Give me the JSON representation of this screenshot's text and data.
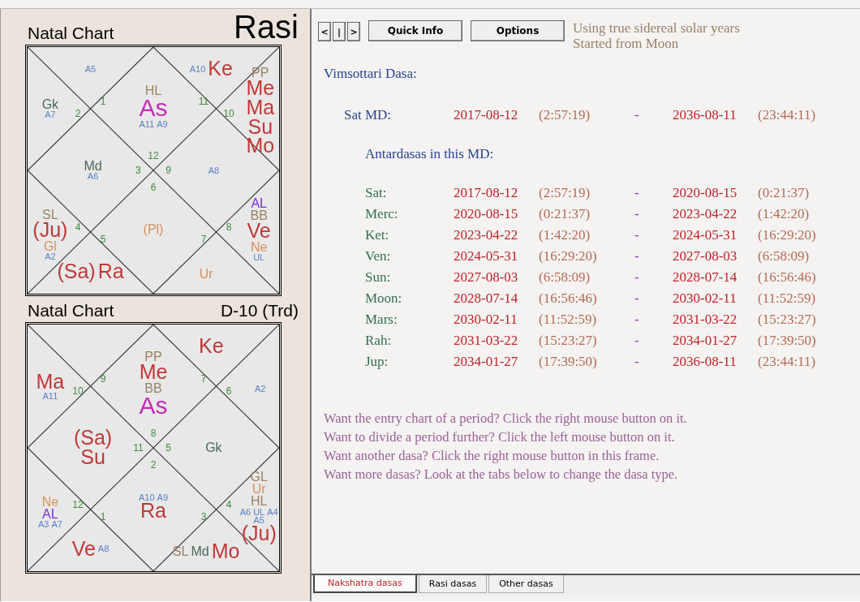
{
  "charts": [
    {
      "title": "Natal Chart",
      "name": "Rasi",
      "name_large": true,
      "houses": [
        {
          "kind": "top_left",
          "sign": "1",
          "labels": [
            {
              "text": "A5",
              "kind": "arudha"
            }
          ]
        },
        {
          "kind": "top_right",
          "sign": "11",
          "labels": [
            {
              "text": "A10",
              "kind": "arudha"
            },
            {
              "text": "Ke",
              "kind": "planet"
            }
          ]
        },
        {
          "kind": "left_top",
          "sign": "2",
          "labels": [
            {
              "text": "Gk",
              "kind": "upagraha"
            },
            {
              "text": "A7",
              "kind": "arudha"
            }
          ]
        },
        {
          "kind": "top_diamond",
          "sign": "12",
          "labels": [
            {
              "text": "HL",
              "kind": "special_lagna"
            },
            {
              "text": "As",
              "kind": "ascendant"
            },
            {
              "text": "A11",
              "kind": "arudha"
            },
            {
              "text": "A9",
              "kind": "arudha"
            }
          ]
        },
        {
          "kind": "right_top",
          "sign": "10",
          "labels": [
            {
              "text": "PP",
              "kind": "special_lagna"
            },
            {
              "text": "Me",
              "kind": "planet"
            },
            {
              "text": "Ma",
              "kind": "planet"
            },
            {
              "text": "Su",
              "kind": "planet"
            },
            {
              "text": "Mo",
              "kind": "planet"
            }
          ]
        },
        {
          "kind": "left_diamond",
          "sign": "3",
          "labels": [
            {
              "text": "Md",
              "kind": "upagraha"
            },
            {
              "text": "A6",
              "kind": "arudha"
            }
          ]
        },
        {
          "kind": "right_diamond",
          "sign": "9",
          "labels": [
            {
              "text": "A8",
              "kind": "arudha"
            }
          ]
        },
        {
          "kind": "left_bottom",
          "sign": "4",
          "labels": [
            {
              "text": "SL",
              "kind": "special_lagna"
            },
            {
              "text": "(Ju)",
              "kind": "planet"
            },
            {
              "text": "Gl",
              "kind": "outer"
            },
            {
              "text": "A2",
              "kind": "arudha"
            }
          ]
        },
        {
          "kind": "bottom_diamond",
          "sign": "6",
          "labels": [
            {
              "text": "(Pl)",
              "kind": "outer"
            }
          ]
        },
        {
          "kind": "right_bottom",
          "sign": "8",
          "labels": [
            {
              "text": "AL",
              "kind": "arudha_lagna"
            },
            {
              "text": "BB",
              "kind": "special_lagna"
            },
            {
              "text": "Ve",
              "kind": "planet"
            },
            {
              "text": "Ne",
              "kind": "outer"
            },
            {
              "text": "UL",
              "kind": "arudha"
            }
          ]
        },
        {
          "kind": "bottom_left",
          "sign": "5",
          "labels": [
            {
              "text": "(Sa)",
              "kind": "planet"
            },
            {
              "text": "Ra",
              "kind": "planet"
            }
          ]
        },
        {
          "kind": "bottom_right",
          "sign": "7",
          "labels": [
            {
              "text": "Ur",
              "kind": "outer"
            }
          ]
        }
      ]
    },
    {
      "title": "Natal Chart",
      "name": "D-10 (Trd)",
      "name_large": false,
      "houses": [
        {
          "kind": "top_left",
          "sign": "9"
        },
        {
          "kind": "top_right",
          "sign": "7",
          "labels": [
            {
              "text": "Ke",
              "kind": "planet"
            }
          ]
        },
        {
          "kind": "left_top",
          "sign": "10",
          "labels": [
            {
              "text": "Ma",
              "kind": "planet"
            },
            {
              "text": "A11",
              "kind": "arudha"
            }
          ]
        },
        {
          "kind": "top_diamond",
          "sign": "8",
          "labels": [
            {
              "text": "PP",
              "kind": "special_lagna"
            },
            {
              "text": "Me",
              "kind": "planet"
            },
            {
              "text": "BB",
              "kind": "special_lagna"
            },
            {
              "text": "As",
              "kind": "ascendant"
            }
          ]
        },
        {
          "kind": "right_top",
          "sign": "6",
          "labels": [
            {
              "text": "A2",
              "kind": "arudha"
            }
          ]
        },
        {
          "kind": "left_diamond",
          "sign": "11",
          "labels": [
            {
              "text": "(Sa)",
              "kind": "planet"
            },
            {
              "text": "Su",
              "kind": "planet"
            }
          ]
        },
        {
          "kind": "right_diamond",
          "sign": "5",
          "labels": [
            {
              "text": "Gk",
              "kind": "upagraha"
            }
          ]
        },
        {
          "kind": "left_bottom",
          "sign": "12",
          "labels": [
            {
              "text": "Ne",
              "kind": "outer"
            },
            {
              "text": "AL",
              "kind": "arudha_lagna"
            },
            {
              "text": "A3",
              "kind": "arudha"
            },
            {
              "text": "A7",
              "kind": "arudha"
            }
          ]
        },
        {
          "kind": "bottom_diamond",
          "sign": "2",
          "labels": [
            {
              "text": "A10",
              "kind": "arudha"
            },
            {
              "text": "A9",
              "kind": "arudha"
            },
            {
              "text": "Ra",
              "kind": "planet"
            }
          ]
        },
        {
          "kind": "right_bottom",
          "sign": "4",
          "labels": [
            {
              "text": "GL",
              "kind": "special_lagna"
            },
            {
              "text": "Ur",
              "kind": "outer"
            },
            {
              "text": "HL",
              "kind": "special_lagna"
            },
            {
              "text": "A6",
              "kind": "arudha"
            },
            {
              "text": "UL",
              "kind": "arudha"
            },
            {
              "text": "A4",
              "kind": "arudha"
            },
            {
              "text": "A5",
              "kind": "arudha"
            },
            {
              "text": "(Ju)",
              "kind": "planet"
            }
          ]
        },
        {
          "kind": "bottom_left",
          "sign": "1",
          "labels": [
            {
              "text": "Ve",
              "kind": "planet"
            },
            {
              "text": "A8",
              "kind": "arudha"
            }
          ]
        },
        {
          "kind": "bottom_right",
          "sign": "3",
          "labels": [
            {
              "text": "SL",
              "kind": "special_lagna"
            },
            {
              "text": "Md",
              "kind": "upagraha"
            },
            {
              "text": "Mo",
              "kind": "planet"
            }
          ]
        }
      ]
    }
  ],
  "nav_buttons": [
    "<",
    "|",
    ">"
  ],
  "buttons": [
    "Quick Info",
    "Options"
  ],
  "settings_note": [
    "Using true sidereal solar years",
    "Started from Moon"
  ],
  "dasa_title": "Vimsottari Dasa:",
  "maha_dasa": {
    "name": "Sat MD:",
    "start_date": "2017-08-12",
    "start_time": "(2:57:19)",
    "separator": "-",
    "end_date": "2036-08-11",
    "end_time": "(23:44:11)"
  },
  "antardasa_title": "Antardasas in this MD:",
  "antardasas": [
    {
      "name": "Sat:",
      "start_date": "2017-08-12",
      "start_time": "(2:57:19)",
      "separator": "-",
      "end_date": "2020-08-15",
      "end_time": "(0:21:37)"
    },
    {
      "name": "Merc:",
      "start_date": "2020-08-15",
      "start_time": "(0:21:37)",
      "separator": "-",
      "end_date": "2023-04-22",
      "end_time": "(1:42:20)"
    },
    {
      "name": "Ket:",
      "start_date": "2023-04-22",
      "start_time": "(1:42:20)",
      "separator": "-",
      "end_date": "2024-05-31",
      "end_time": "(16:29:20)"
    },
    {
      "name": "Ven:",
      "start_date": "2024-05-31",
      "start_time": "(16:29:20)",
      "separator": "-",
      "end_date": "2027-08-03",
      "end_time": "(6:58:09)"
    },
    {
      "name": "Sun:",
      "start_date": "2027-08-03",
      "start_time": "(6:58:09)",
      "separator": "-",
      "end_date": "2028-07-14",
      "end_time": "(16:56:46)"
    },
    {
      "name": "Moon:",
      "start_date": "2028-07-14",
      "start_time": "(16:56:46)",
      "separator": "-",
      "end_date": "2030-02-11",
      "end_time": "(11:52:59)"
    },
    {
      "name": "Mars:",
      "start_date": "2030-02-11",
      "start_time": "(11:52:59)",
      "separator": "-",
      "end_date": "2031-03-22",
      "end_time": "(15:23:27)"
    },
    {
      "name": "Rah:",
      "start_date": "2031-03-22",
      "start_time": "(15:23:27)",
      "separator": "-",
      "end_date": "2034-01-27",
      "end_time": "(17:39:50)"
    },
    {
      "name": "Jup:",
      "start_date": "2034-01-27",
      "start_time": "(17:39:50)",
      "separator": "-",
      "end_date": "2036-08-11",
      "end_time": "(23:44:11)"
    }
  ],
  "hints": [
    "Want the entry chart of a period? Click the right mouse button on it.",
    "Want to divide a period further? Click the left mouse button on it.",
    "Want another dasa? Click the right mouse button in this frame.",
    "Want more dasas? Look at the tabs below to change the dasa type."
  ],
  "tabs": [
    {
      "label": "Nakshatra dasas",
      "selected": true
    },
    {
      "label": "Rasi dasas",
      "selected": false
    },
    {
      "label": "Other dasas",
      "selected": false
    }
  ]
}
